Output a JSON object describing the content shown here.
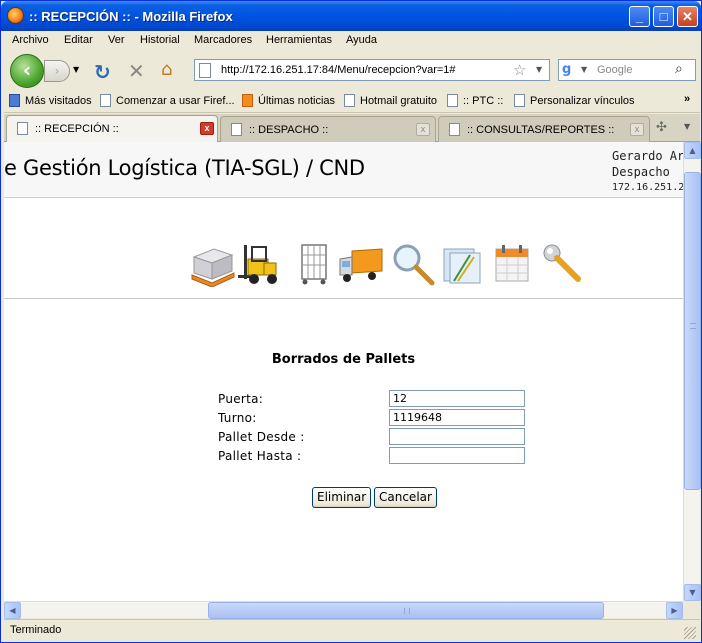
{
  "window": {
    "title": ":: RECEPCIÓN :: - Mozilla Firefox"
  },
  "menu": [
    "Archivo",
    "Editar",
    "Ver",
    "Historial",
    "Marcadores",
    "Herramientas",
    "Ayuda"
  ],
  "nav": {
    "url": "http://172.16.251.17:84/Menu/recepcion?var=1#",
    "search_placeholder": "Google"
  },
  "bookmarks": [
    "Más visitados",
    "Comenzar a usar Firef...",
    "Últimas noticias",
    "Hotmail gratuito",
    ":: PTC ::",
    "Personalizar vínculos"
  ],
  "tabs": [
    {
      "label": ":: RECEPCIÓN ::",
      "active": true
    },
    {
      "label": ":: DESPACHO ::",
      "active": false
    },
    {
      "label": ":: CONSULTAS/REPORTES ::",
      "active": false
    }
  ],
  "page": {
    "header_title": "e Gestión Logística (TIA-SGL) / CND",
    "user_name": "Gerardo Ar",
    "user_role": "Despacho",
    "user_ip": "172.16.251.2",
    "app_icons": [
      "pallet-icon",
      "forklift-icon",
      "cage-cart-icon",
      "truck-icon",
      "magnifier-icon",
      "folders-icon",
      "calendar-icon",
      "wrench-icon"
    ],
    "form": {
      "title": "Borrados de Pallets",
      "puerta_label": "Puerta:",
      "puerta_value": "12",
      "turno_label": "Turno:",
      "turno_value": "1119648",
      "desde_label": "Pallet Desde :",
      "desde_value": "",
      "hasta_label": "Pallet Hasta :",
      "hasta_value": "",
      "eliminar_label": "Eliminar",
      "cancelar_label": "Cancelar"
    }
  },
  "status": {
    "text": "Terminado"
  }
}
